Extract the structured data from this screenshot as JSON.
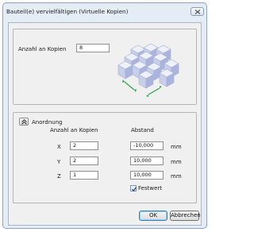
{
  "window": {
    "title": "Bauteil(e) vervielfältigen (Virtuelle Kopien)"
  },
  "copies": {
    "label": "Anzahl an Kopien",
    "value": "8"
  },
  "arrangement": {
    "title": "Anordnung",
    "col_copies": "Anzahl an Kopien",
    "col_distance": "Abstand",
    "unit": "mm",
    "rows": [
      {
        "axis": "X",
        "count": "2",
        "distance": "-10,000"
      },
      {
        "axis": "Y",
        "count": "2",
        "distance": "10,000"
      },
      {
        "axis": "Z",
        "count": "1",
        "distance": "10,000"
      }
    ],
    "fixed_label": "Festwert",
    "fixed_checked": true
  },
  "buttons": {
    "ok": "OK",
    "cancel": "Abbrechen"
  },
  "colors": {
    "window_frame": "#e4ecf6",
    "cube_face": "#c9d1ea",
    "arrow": "#2fa24a"
  },
  "icons": {
    "close": "close-icon",
    "collapse": "chevron-up-icon",
    "illustration": "cubes-array-icon"
  }
}
